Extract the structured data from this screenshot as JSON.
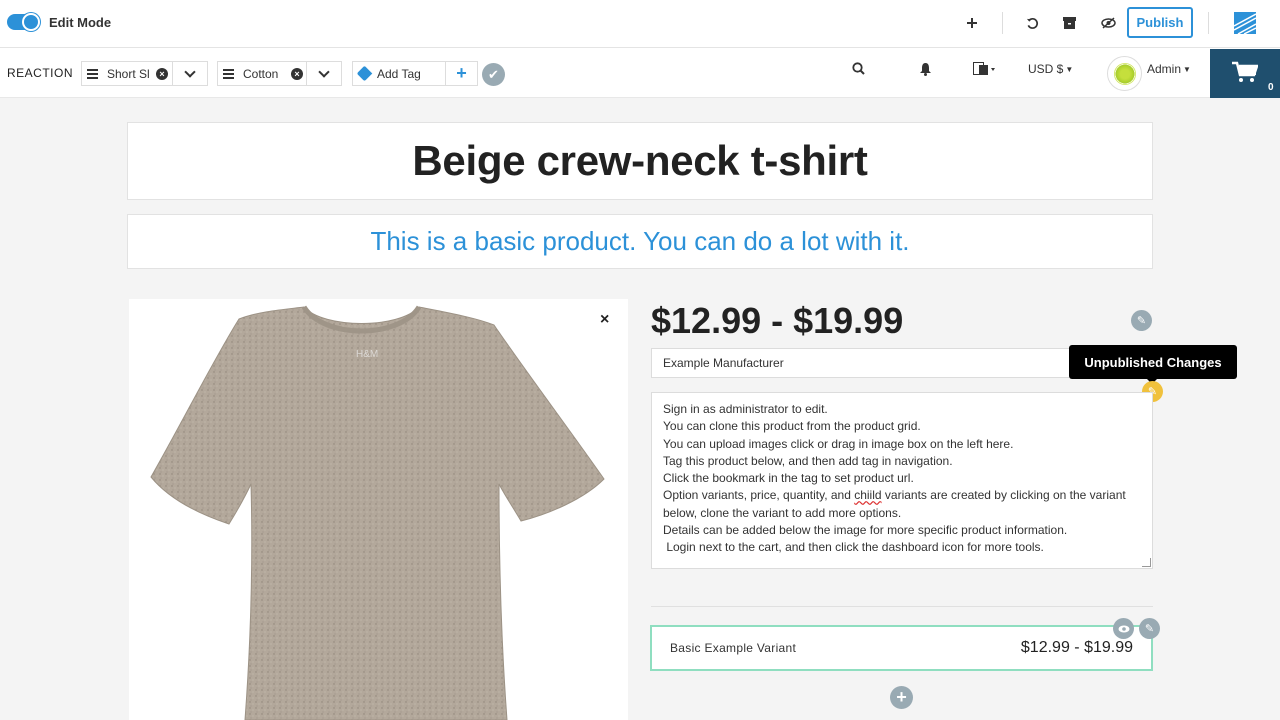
{
  "adminbar": {
    "edit_mode_label": "Edit Mode",
    "edit_mode_on": true,
    "publish_label": "Publish",
    "icons": [
      "plus-icon",
      "undo-icon",
      "archive-icon",
      "eye-slash-icon"
    ]
  },
  "navbar": {
    "brand": "REACTION",
    "tags": [
      {
        "label": "Short Sl"
      },
      {
        "label": "Cotton"
      }
    ],
    "add_tag_placeholder": "Add Tag",
    "currency": "USD $",
    "user": "Admin",
    "cart_count": "0"
  },
  "product": {
    "title": "Beige crew-neck t-shirt",
    "subtitle": "This is a basic product. You can do a lot with it.",
    "price_range": "$12.99 - $19.99",
    "manufacturer": "Example Manufacturer",
    "tooltip": "Unpublished Changes",
    "description": [
      "Sign in as administrator to edit.",
      "You can clone this product from the product grid.",
      "You can upload images click or drag in image box on the left here.",
      "Tag this product below, and then add tag in navigation.",
      "Click the bookmark in the tag to set product url.",
      "Option variants, price, quantity, and ",
      "below, clone the variant to add more options.",
      "Details can be added below the image for more specific product information.",
      " Login next to the cart, and then click the dashboard icon for more tools."
    ],
    "description_misspelled": "chiild",
    "description_line6_tail": " variants are created by clicking on the variant",
    "variant": {
      "name": "Basic Example Variant",
      "price": "$12.99 - $19.99"
    }
  },
  "colors": {
    "accent": "#2c91d8",
    "cart_bg": "#1f4f6e",
    "variant_border": "#8fdec0",
    "warning": "#f0c13c"
  }
}
